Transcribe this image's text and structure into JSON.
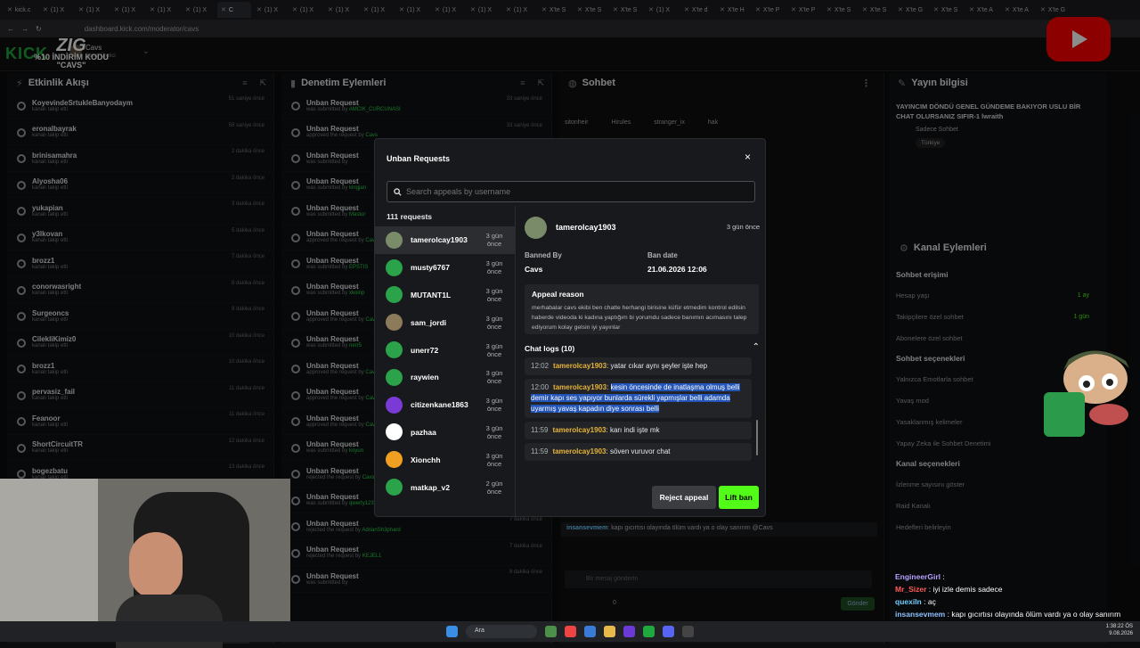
{
  "browser": {
    "url": "dashboard.kick.com/moderator/cavs",
    "tabs": [
      "kick.c",
      "(1) X",
      "(1) X",
      "(1) X",
      "(1) X",
      "(1) X",
      "C",
      "(1) X",
      "(1) X",
      "(1) X",
      "(1) X",
      "(1) X",
      "(1) X",
      "(1) X",
      "(1) X",
      "X'te S",
      "X'te S",
      "X'te S",
      "(1) X",
      "X'te d",
      "X'te H",
      "X'te P",
      "X'te P",
      "X'te S",
      "X'te S",
      "X'te G",
      "X'te S",
      "X'te A",
      "X'te A",
      "X'te G"
    ]
  },
  "promo": {
    "brand": "ZIG",
    "line1": "%10 İNDİRİM KODU",
    "line2": "\"CAVS\""
  },
  "header": {
    "logo": "KICK",
    "channel": "Cavs",
    "role": "Şahsi Üretici"
  },
  "panels": {
    "activity": {
      "title": "Etkinlik Akışı",
      "rows": [
        {
          "name": "KoyevindeSrtukleBanyodaym",
          "sub": "kanalı takip etti",
          "time": "51 saniye önce"
        },
        {
          "name": "eronalbayrak",
          "sub": "kanalı takip etti",
          "time": "58 saniye önce"
        },
        {
          "name": "brinisamahra",
          "sub": "kanalı takip etti",
          "time": "2 dakika önce"
        },
        {
          "name": "Alyosha06",
          "sub": "kanalı takip etti",
          "time": "2 dakika önce"
        },
        {
          "name": "yukapian",
          "sub": "kanalı takip etti",
          "time": "3 dakika önce"
        },
        {
          "name": "y3lkovan",
          "sub": "kanalı takip etti",
          "time": "5 dakika önce"
        },
        {
          "name": "brozz1",
          "sub": "kanalı takip etti",
          "time": "7 dakika önce"
        },
        {
          "name": "conorwasright",
          "sub": "kanalı takip etti",
          "time": "8 dakika önce"
        },
        {
          "name": "Surgeoncs",
          "sub": "kanalı takip etti",
          "time": "9 dakika önce"
        },
        {
          "name": "CilekliKimiz0",
          "sub": "kanalı takip etti",
          "time": "10 dakika önce"
        },
        {
          "name": "brozz1",
          "sub": "kanalı takip etti",
          "time": "10 dakika önce"
        },
        {
          "name": "pervasiz_fail",
          "sub": "kanalı takip etti",
          "time": "11 dakika önce"
        },
        {
          "name": "Feanoor",
          "sub": "kanalı takip etti",
          "time": "11 dakika önce"
        },
        {
          "name": "ShortCircuitTR",
          "sub": "kanalı takip etti",
          "time": "12 dakika önce"
        },
        {
          "name": "bogezbatu",
          "sub": "kanalı takip etti",
          "time": "13 dakika önce"
        }
      ]
    },
    "moderation": {
      "title": "Denetim Eylemleri",
      "rows": [
        {
          "name": "Unban Request",
          "sub": "was submitted by",
          "user": "AMCIK_CURCUNASI",
          "time": "33 saniye önce"
        },
        {
          "name": "Unban Request",
          "sub": "approved the request by",
          "user": "Cavs",
          "time": "33 saniye önce"
        },
        {
          "name": "Unban Request",
          "sub": "was submitted by",
          "user": "",
          "time": "1 dakika önce"
        },
        {
          "name": "Unban Request",
          "sub": "was submitted by",
          "user": "kingjan",
          "time": "1 dakika önce"
        },
        {
          "name": "Unban Request",
          "sub": "was submitted by",
          "user": "Mastur",
          "time": "2 dakika önce"
        },
        {
          "name": "Unban Request",
          "sub": "approved the request by",
          "user": "Cavs",
          "time": "2 dakika önce"
        },
        {
          "name": "Unban Request",
          "sub": "was submitted by",
          "user": "EPSTIS",
          "time": "3 dakika önce"
        },
        {
          "name": "Unban Request",
          "sub": "was submitted by",
          "user": "xkoinp",
          "time": "3 dakika önce"
        },
        {
          "name": "Unban Request",
          "sub": "approved the request by",
          "user": "Cavs",
          "time": "3 dakika önce"
        },
        {
          "name": "Unban Request",
          "sub": "was submitted by",
          "user": "nerr5",
          "time": "4 dakika önce"
        },
        {
          "name": "Unban Request",
          "sub": "approved the request by",
          "user": "Cavs",
          "time": "4 dakika önce"
        },
        {
          "name": "Unban Request",
          "sub": "approved the request by",
          "user": "Cavs",
          "time": "4 dakika önce"
        },
        {
          "name": "Unban Request",
          "sub": "approved the request by",
          "user": "Cavs",
          "time": "5 dakika önce"
        },
        {
          "name": "Unban Request",
          "sub": "was submitted by",
          "user": "koyun",
          "time": "5 dakika önce"
        },
        {
          "name": "Unban Request",
          "sub": "rejected the request by",
          "user": "Cavs",
          "time": "5 dakika önce"
        },
        {
          "name": "Unban Request",
          "sub": "was submitted by",
          "user": "qwerty123123",
          "time": "6 dakika önce"
        },
        {
          "name": "Unban Request",
          "sub": "rejected the request by",
          "user": "AdrianSh3phard",
          "time": "7 dakika önce"
        },
        {
          "name": "Unban Request",
          "sub": "rejected the request by",
          "user": "KEJEL1",
          "time": "7 dakika önce"
        },
        {
          "name": "Unban Request",
          "sub": "was submitted by",
          "user": "",
          "time": "8 dakika önce"
        }
      ]
    },
    "chat": {
      "title": "Sohbet",
      "pinned": [
        "sitonheir",
        "Hirules",
        "stranger_ix",
        "hak"
      ],
      "message_user": "insansevmem",
      "message": "kapı gıcırtısı olayında ölüm vardı ya o olay sanırım @Cavs",
      "input_placeholder": "Bir mesaj gönderin",
      "send_label": "Gönder",
      "points": "0"
    },
    "stream": {
      "title": "Yayın bilgisi",
      "description": "YAYINCIM DÖNDÜ GENEL GÜNDEME BAKIYOR USLU BİR CHAT OLURSANIZ SIFIR-1 lwraith",
      "category": "Sadece Sohbet",
      "tag": "Türkiye"
    },
    "channel_actions": {
      "title": "Kanal Eylemleri",
      "sections": [
        {
          "header": "Sohbet erişimi",
          "items": [
            {
              "label": "Hesap yaşı",
              "value": "1 ay"
            },
            {
              "label": "Takipçilere özel sohbet",
              "value": "1 gün"
            },
            {
              "label": "Abonelere özel sohbet",
              "value": ""
            }
          ]
        },
        {
          "header": "Sohbet seçenekleri",
          "items": [
            {
              "label": "Yalnızca Emotlarla sohbet",
              "value": ""
            },
            {
              "label": "Yavaş mod",
              "value": ""
            },
            {
              "label": "Yasaklanmış kelimeler",
              "value": ""
            },
            {
              "label": "Yapay Zeka ile Sohbet Denetimi",
              "value": ""
            }
          ]
        },
        {
          "header": "Kanal seçenekleri",
          "items": [
            {
              "label": "İzlenme sayısını göster",
              "value": ""
            },
            {
              "label": "Raid Kanalı",
              "value": ""
            },
            {
              "label": "Hedefleri belirleyin",
              "value": ""
            }
          ]
        }
      ]
    }
  },
  "modal": {
    "title": "Unban Requests",
    "close": "×",
    "search_placeholder": "Search appeals by username",
    "count": "111 requests",
    "requests": [
      {
        "user": "tamerolcay1903",
        "time": "3 gün önce",
        "color": "#7a8b6a"
      },
      {
        "user": "musty6767",
        "time": "3 gün önce",
        "color": "#2aa34a"
      },
      {
        "user": "MUTANT1L",
        "time": "3 gün önce",
        "color": "#2aa34a"
      },
      {
        "user": "sam_jordi",
        "time": "3 gün önce",
        "color": "#8b7b5a"
      },
      {
        "user": "unerr72",
        "time": "3 gün önce",
        "color": "#2aa34a"
      },
      {
        "user": "raywien",
        "time": "3 gün önce",
        "color": "#2aa34a"
      },
      {
        "user": "citizenkane1863",
        "time": "3 gün önce",
        "color": "#7a3ad6"
      },
      {
        "user": "pazhaa",
        "time": "3 gün önce",
        "color": "#ffffff"
      },
      {
        "user": "Xionchh",
        "time": "3 gün önce",
        "color": "#f0a020"
      },
      {
        "user": "matkap_v2",
        "time": "2 gün önce",
        "color": "#2aa34a"
      }
    ],
    "detail": {
      "user": "tamerolcay1903",
      "time": "3 gün önce",
      "banned_by_label": "Banned By",
      "banned_by": "Cavs",
      "ban_date_label": "Ban date",
      "ban_date": "21.06.2026 12:06",
      "appeal_reason_label": "Appeal reason",
      "appeal_reason": "merhabalar cavs ekibi ben chatte herhangi birisine küfür etmedim kontrol edilsin haberde videoda ki kadına yaptığım bi yorumdu sadece banımın acımasını talep ediyorum kolay gelsin iyi yayınlar",
      "chat_logs_label": "Chat logs (10)",
      "logs": [
        {
          "time": "12:02",
          "user": "tamerolcay1903",
          "text": "yatar cıkar aynı şeyler işte hep"
        },
        {
          "time": "12:00",
          "user": "tamerolcay1903",
          "text": "kesin öncesinde de inatlaşma olmuş belli demir kapı ses yapıyor bunlarda sürekli yapmışlar belli adamda uyarmış yavaş kapadın diye sonrası belli"
        },
        {
          "time": "11:59",
          "user": "tamerolcay1903",
          "text": "karı indi işte mk"
        },
        {
          "time": "11:59",
          "user": "tamerolcay1903",
          "text": "söven vuruvor chat"
        }
      ],
      "reject_label": "Reject appeal",
      "lift_label": "Lift ban"
    }
  },
  "bottom_chat": [
    {
      "user": "EngineerGirl",
      "text": ""
    },
    {
      "user": "Mr_Sizer",
      "text": "iyi izle demis sadece"
    },
    {
      "user": "quexiln",
      "text": "aç"
    },
    {
      "user": "insansevmem",
      "text": "kapı gıcırtısı olayında ölüm vardı ya o olay sanırım @Cavs"
    }
  ],
  "taskbar": {
    "search": "Ara",
    "clock": "1:38:22 ÖS",
    "date": "9.08.2026"
  },
  "colors": {
    "kick_green": "#53fc18",
    "highlight": "#2354b7",
    "username": "#e7b43a"
  }
}
